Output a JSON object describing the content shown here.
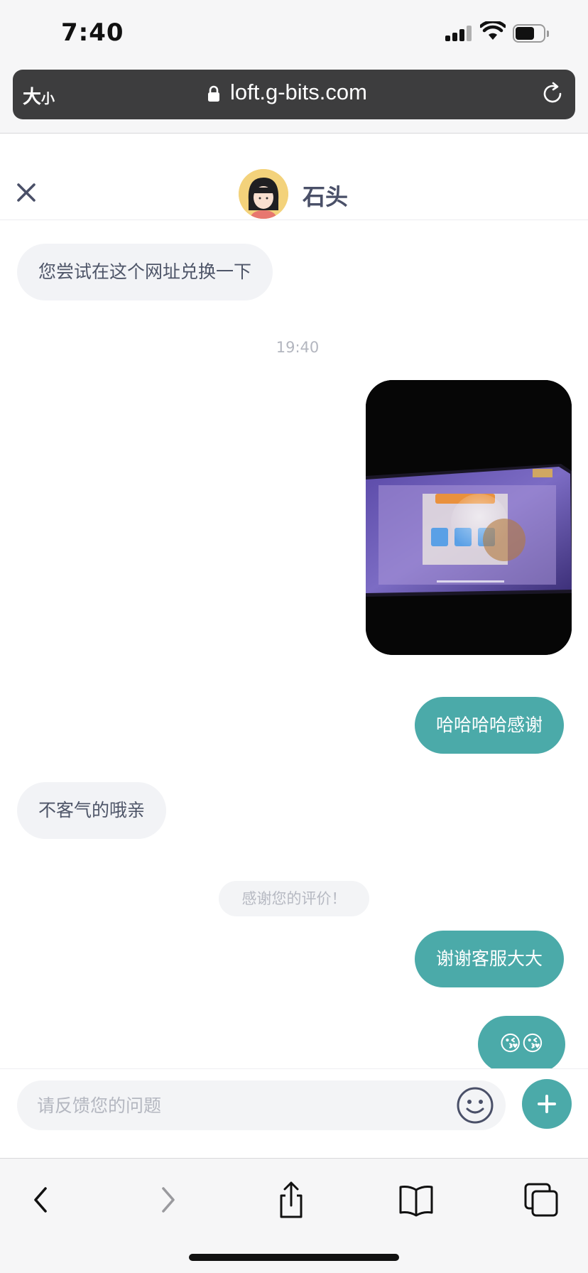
{
  "status_bar": {
    "time": "7:40"
  },
  "browser": {
    "text_size_label": "大",
    "text_size_small": "小",
    "url": "loft.g-bits.com"
  },
  "chat_header": {
    "agent_name": "石头"
  },
  "messages": [
    {
      "direction": "in",
      "text": "您尝试在这个网址兑换一下"
    },
    {
      "type": "timestamp",
      "text": "19:40"
    },
    {
      "direction": "out",
      "type": "image"
    },
    {
      "direction": "out",
      "text": "哈哈哈哈感谢"
    },
    {
      "direction": "in",
      "text": "不客气的哦亲"
    },
    {
      "type": "system",
      "text": "感谢您的评价！"
    },
    {
      "direction": "out",
      "text": "谢谢客服大大"
    },
    {
      "direction": "out",
      "text": "😘😘"
    }
  ],
  "input": {
    "placeholder": "请反馈您的问题"
  },
  "colors": {
    "accent": "#4baaa9",
    "incoming_bubble": "#f2f3f6",
    "incoming_text": "#4e5568"
  }
}
